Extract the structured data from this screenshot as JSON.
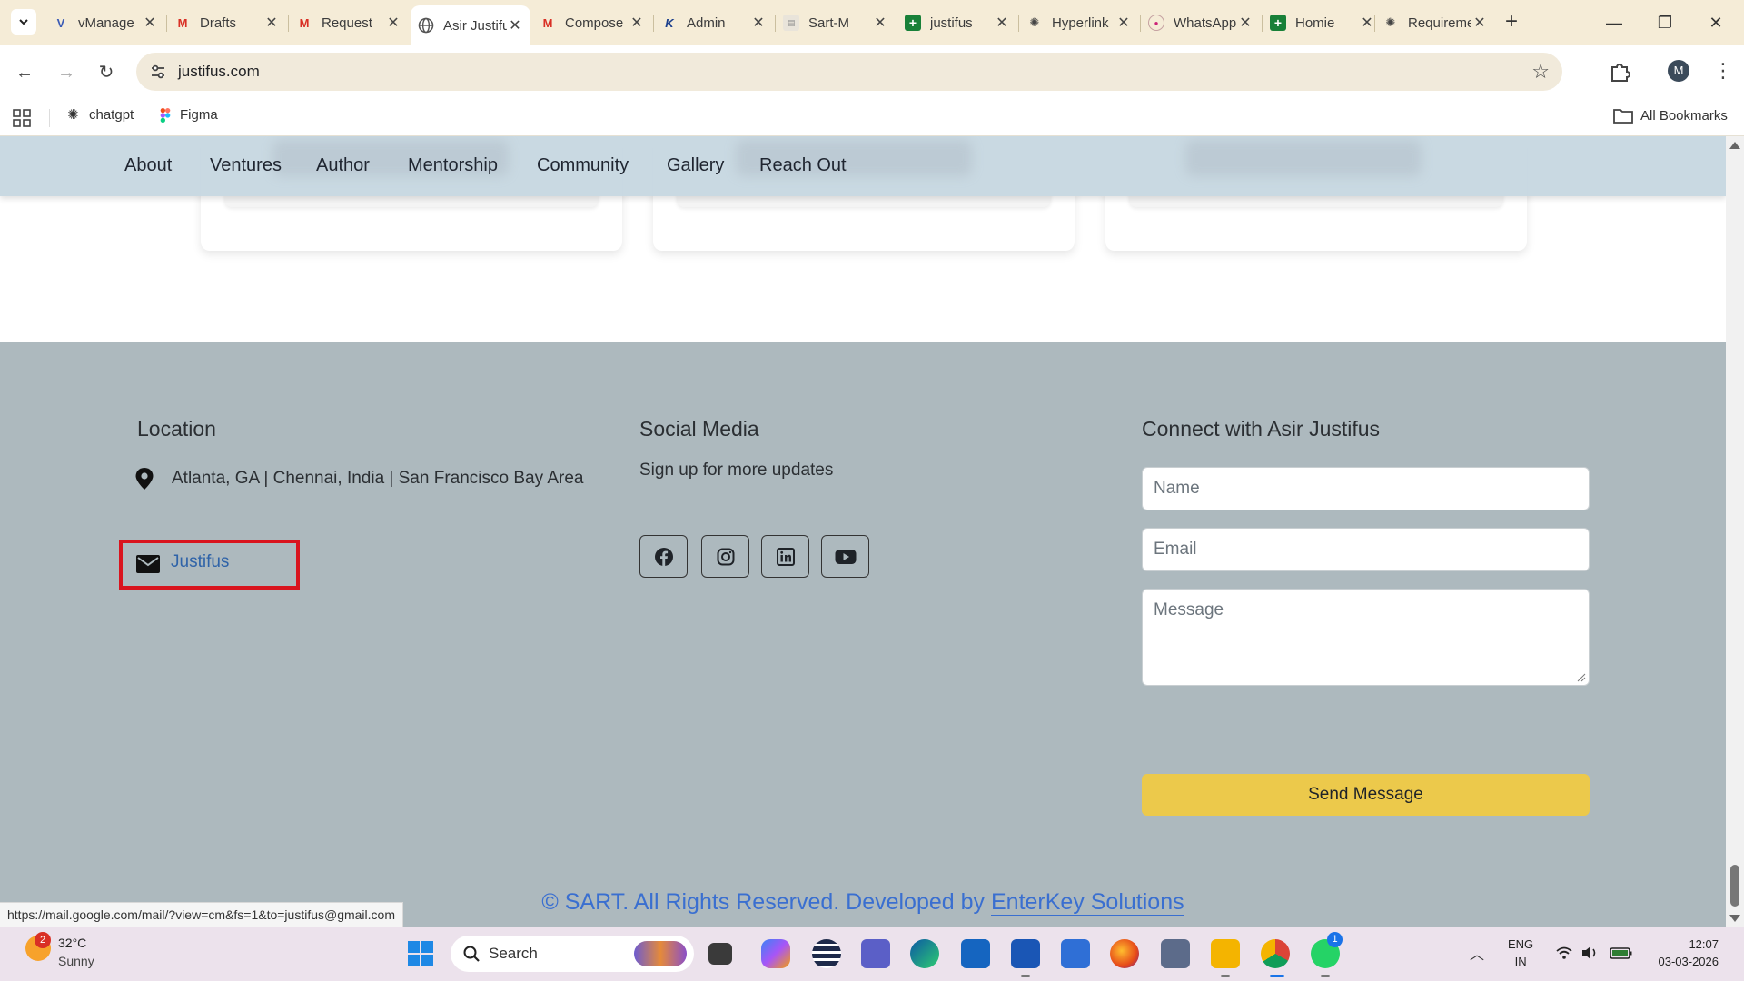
{
  "browser": {
    "tabs": [
      {
        "title": "vManage",
        "icon": "vmanage-icon"
      },
      {
        "title": "Drafts",
        "icon": "gmail-icon"
      },
      {
        "title": "Request",
        "icon": "gmail-icon"
      },
      {
        "title": "Asir Justifus",
        "icon": "globe-icon",
        "active": true
      },
      {
        "title": "Compose",
        "icon": "gmail-icon"
      },
      {
        "title": "Admin",
        "icon": "admin-icon"
      },
      {
        "title": "Sart-M",
        "icon": "doc-icon"
      },
      {
        "title": "justifus",
        "icon": "sheets-icon"
      },
      {
        "title": "Hyperlink",
        "icon": "chatgpt-icon"
      },
      {
        "title": "WhatsApp",
        "icon": "whatsapp-icon"
      },
      {
        "title": "Homie",
        "icon": "sheets-icon"
      },
      {
        "title": "Requirements",
        "icon": "chatgpt-icon"
      }
    ],
    "url": "justifus.com",
    "profile_initial": "M",
    "bookmarks": [
      {
        "label": "chatgpt",
        "icon": "chatgpt-icon"
      },
      {
        "label": "Figma",
        "icon": "figma-icon"
      }
    ],
    "all_bookmarks": "All Bookmarks",
    "status_url": "https://mail.google.com/mail/?view=cm&fs=1&to=justifus@gmail.com"
  },
  "site": {
    "nav": [
      "About",
      "Ventures",
      "Author",
      "Mentorship",
      "Community",
      "Gallery",
      "Reach Out"
    ],
    "footer": {
      "location_heading": "Location",
      "location_text": "Atlanta, GA | Chennai, India | San Francisco Bay Area",
      "email_link": "Justifus",
      "social_heading": "Social Media",
      "social_sub": "Sign up for more updates",
      "social_icons": [
        "facebook-icon",
        "instagram-icon",
        "linkedin-icon",
        "youtube-icon"
      ],
      "connect_heading": "Connect with Asir Justifus",
      "name_placeholder": "Name",
      "email_placeholder": "Email",
      "message_placeholder": "Message",
      "send_label": "Send Message",
      "copyright_prefix": "© SART. All Rights Reserved. Developed by ",
      "copyright_link": "EnterKey Solutions"
    },
    "colors": {
      "footer_bg": "#adb9be",
      "send_button": "#ecc94b",
      "link": "#2f63a8",
      "highlight_box": "#d9141e"
    }
  },
  "taskbar": {
    "weather_temp": "32°C",
    "weather_cond": "Sunny",
    "weather_badge": "2",
    "search_label": "Search",
    "whatsapp_badge": "1",
    "lang_1": "ENG",
    "lang_2": "IN",
    "time": "12:07",
    "date": "03-03-2026"
  }
}
